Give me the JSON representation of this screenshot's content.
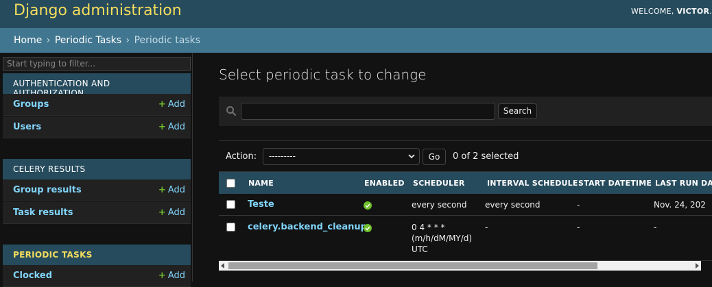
{
  "header": {
    "branding": "Django administration",
    "welcome": "WELCOME,",
    "user": "VICTOR",
    "trailing": ". V"
  },
  "breadcrumbs": {
    "items": [
      "Home",
      "Periodic Tasks",
      "Periodic tasks"
    ],
    "separator": "›"
  },
  "sidebar": {
    "filter_placeholder": "Start typing to filter...",
    "add_label": "Add",
    "apps": [
      {
        "caption": "AUTHENTICATION AND AUTHORIZATION",
        "models": [
          "Groups",
          "Users"
        ]
      },
      {
        "caption": "CELERY RESULTS",
        "models": [
          "Group results",
          "Task results"
        ]
      },
      {
        "caption": "PERIODIC TASKS",
        "models": [
          "Clocked"
        ]
      }
    ]
  },
  "content": {
    "title": "Select periodic task to change",
    "search_button": "Search",
    "search_value": "",
    "action_label": "Action:",
    "action_selected": "---------",
    "go_button": "Go",
    "counter": "0 of 2 selected"
  },
  "table": {
    "headers": [
      "NAME",
      "ENABLED",
      "SCHEDULER",
      "INTERVAL SCHEDULE",
      "START DATETIME",
      "LAST RUN DA"
    ],
    "rows": [
      {
        "name": "Teste",
        "scheduler": "every second",
        "interval": "every second",
        "start": "-",
        "last_run": "Nov. 24, 202"
      },
      {
        "name": "celery.backend_cleanup",
        "scheduler_lines": [
          "0 4 * * *",
          "(m/h/dM/MY/d)",
          "UTC"
        ],
        "interval": "-",
        "start": "-",
        "last_run": "-"
      }
    ]
  },
  "colors": {
    "header_bg": "#264b5d",
    "breadcrumb_bg": "#417690",
    "branding": "#f5dd5d",
    "link": "#81d4fa",
    "add_plus": "#70bf2b",
    "enabled_ok": "#70bf2b"
  }
}
